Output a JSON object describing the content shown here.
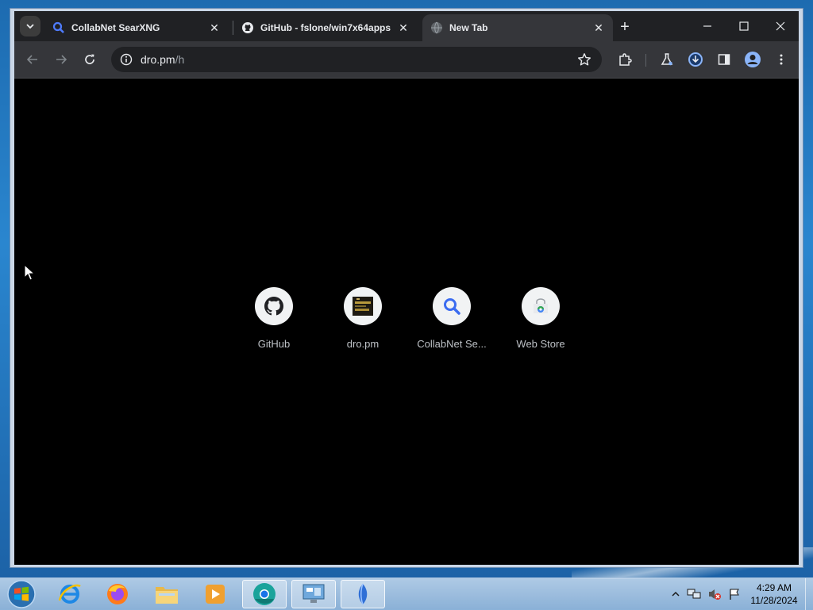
{
  "browser": {
    "tabs": [
      {
        "label": "CollabNet SearXNG",
        "favicon": "search-icon",
        "active": false
      },
      {
        "label": "GitHub - fslone/win7x64apps",
        "favicon": "github-icon",
        "active": false
      },
      {
        "label": "New Tab",
        "favicon": "globe-icon",
        "active": true
      }
    ],
    "tab_close": "✕",
    "new_tab": "+",
    "window_controls": {
      "minimize": "minimize-icon",
      "maximize": "maximize-icon",
      "close": "close-icon"
    },
    "address": {
      "host": "dro.pm",
      "path": "/h"
    },
    "toolbar_icons": [
      "back-icon",
      "forward-icon",
      "reload-icon",
      "site-info-icon",
      "bookmark-star-icon",
      "extensions-icon",
      "labs-flask-icon",
      "download-icon",
      "side-panel-icon",
      "profile-icon",
      "menu-icon"
    ]
  },
  "new_tab_page": {
    "shortcuts": [
      {
        "name": "GitHub",
        "icon": "github-icon"
      },
      {
        "name": "dro.pm",
        "icon": "dro-pm-thumbnail-icon"
      },
      {
        "name": "CollabNet Se...",
        "icon": "search-icon"
      },
      {
        "name": "Web Store",
        "icon": "web-store-icon"
      }
    ]
  },
  "taskbar": {
    "apps": [
      "internet-explorer-icon",
      "firefox-icon",
      "explorer-folder-icon",
      "media-player-icon",
      "chromium-icon",
      "control-panel-icon",
      "app-sail-icon"
    ],
    "tray_icons": [
      "show-hidden-icons-icon",
      "network-icon",
      "volume-muted-icon",
      "action-center-flag-icon"
    ],
    "time": "4:29 AM",
    "date": "11/28/2024"
  },
  "colors": {
    "accent": "#8ab4f8",
    "content_bg": "#000000",
    "tabstrip_bg": "#202124",
    "toolbar_bg": "#35363a"
  }
}
